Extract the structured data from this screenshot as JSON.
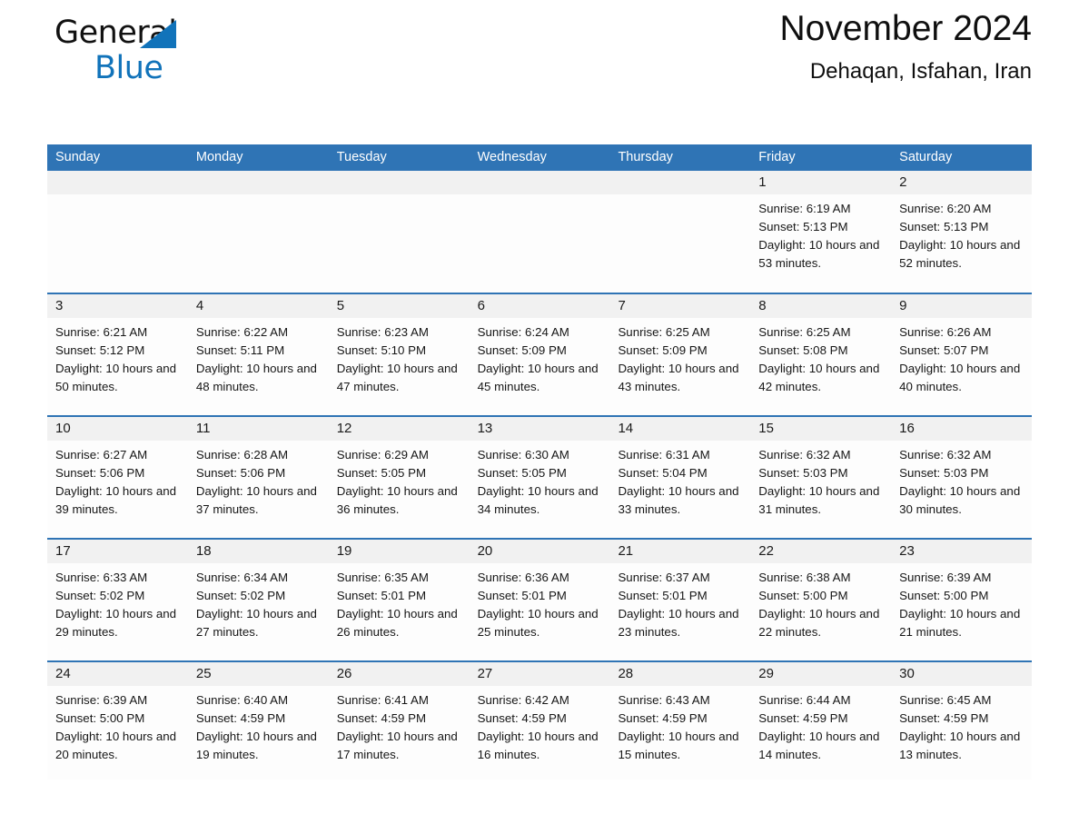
{
  "brand": {
    "line1": "General",
    "line2": "Blue",
    "triangle_icon": "triangle-icon",
    "color_dark": "#111111",
    "color_blue": "#1173ba"
  },
  "header": {
    "month_title": "November 2024",
    "location": "Dehaqan, Isfahan, Iran"
  },
  "theme": {
    "header_blue": "#2f74b5",
    "row_rule_blue": "#2f74b5",
    "daynum_bg": "#f1f1f1",
    "page_bg": "#ffffff"
  },
  "calendar": {
    "weekday_headers": [
      "Sunday",
      "Monday",
      "Tuesday",
      "Wednesday",
      "Thursday",
      "Friday",
      "Saturday"
    ],
    "weeks": [
      [
        {
          "day": "",
          "sunrise": "",
          "sunset": "",
          "daylight": "",
          "empty": true
        },
        {
          "day": "",
          "sunrise": "",
          "sunset": "",
          "daylight": "",
          "empty": true
        },
        {
          "day": "",
          "sunrise": "",
          "sunset": "",
          "daylight": "",
          "empty": true
        },
        {
          "day": "",
          "sunrise": "",
          "sunset": "",
          "daylight": "",
          "empty": true
        },
        {
          "day": "",
          "sunrise": "",
          "sunset": "",
          "daylight": "",
          "empty": true
        },
        {
          "day": "1",
          "sunrise": "Sunrise: 6:19 AM",
          "sunset": "Sunset: 5:13 PM",
          "daylight": "Daylight: 10 hours and 53 minutes.",
          "empty": false
        },
        {
          "day": "2",
          "sunrise": "Sunrise: 6:20 AM",
          "sunset": "Sunset: 5:13 PM",
          "daylight": "Daylight: 10 hours and 52 minutes.",
          "empty": false
        }
      ],
      [
        {
          "day": "3",
          "sunrise": "Sunrise: 6:21 AM",
          "sunset": "Sunset: 5:12 PM",
          "daylight": "Daylight: 10 hours and 50 minutes.",
          "empty": false
        },
        {
          "day": "4",
          "sunrise": "Sunrise: 6:22 AM",
          "sunset": "Sunset: 5:11 PM",
          "daylight": "Daylight: 10 hours and 48 minutes.",
          "empty": false
        },
        {
          "day": "5",
          "sunrise": "Sunrise: 6:23 AM",
          "sunset": "Sunset: 5:10 PM",
          "daylight": "Daylight: 10 hours and 47 minutes.",
          "empty": false
        },
        {
          "day": "6",
          "sunrise": "Sunrise: 6:24 AM",
          "sunset": "Sunset: 5:09 PM",
          "daylight": "Daylight: 10 hours and 45 minutes.",
          "empty": false
        },
        {
          "day": "7",
          "sunrise": "Sunrise: 6:25 AM",
          "sunset": "Sunset: 5:09 PM",
          "daylight": "Daylight: 10 hours and 43 minutes.",
          "empty": false
        },
        {
          "day": "8",
          "sunrise": "Sunrise: 6:25 AM",
          "sunset": "Sunset: 5:08 PM",
          "daylight": "Daylight: 10 hours and 42 minutes.",
          "empty": false
        },
        {
          "day": "9",
          "sunrise": "Sunrise: 6:26 AM",
          "sunset": "Sunset: 5:07 PM",
          "daylight": "Daylight: 10 hours and 40 minutes.",
          "empty": false
        }
      ],
      [
        {
          "day": "10",
          "sunrise": "Sunrise: 6:27 AM",
          "sunset": "Sunset: 5:06 PM",
          "daylight": "Daylight: 10 hours and 39 minutes.",
          "empty": false
        },
        {
          "day": "11",
          "sunrise": "Sunrise: 6:28 AM",
          "sunset": "Sunset: 5:06 PM",
          "daylight": "Daylight: 10 hours and 37 minutes.",
          "empty": false
        },
        {
          "day": "12",
          "sunrise": "Sunrise: 6:29 AM",
          "sunset": "Sunset: 5:05 PM",
          "daylight": "Daylight: 10 hours and 36 minutes.",
          "empty": false
        },
        {
          "day": "13",
          "sunrise": "Sunrise: 6:30 AM",
          "sunset": "Sunset: 5:05 PM",
          "daylight": "Daylight: 10 hours and 34 minutes.",
          "empty": false
        },
        {
          "day": "14",
          "sunrise": "Sunrise: 6:31 AM",
          "sunset": "Sunset: 5:04 PM",
          "daylight": "Daylight: 10 hours and 33 minutes.",
          "empty": false
        },
        {
          "day": "15",
          "sunrise": "Sunrise: 6:32 AM",
          "sunset": "Sunset: 5:03 PM",
          "daylight": "Daylight: 10 hours and 31 minutes.",
          "empty": false
        },
        {
          "day": "16",
          "sunrise": "Sunrise: 6:32 AM",
          "sunset": "Sunset: 5:03 PM",
          "daylight": "Daylight: 10 hours and 30 minutes.",
          "empty": false
        }
      ],
      [
        {
          "day": "17",
          "sunrise": "Sunrise: 6:33 AM",
          "sunset": "Sunset: 5:02 PM",
          "daylight": "Daylight: 10 hours and 29 minutes.",
          "empty": false
        },
        {
          "day": "18",
          "sunrise": "Sunrise: 6:34 AM",
          "sunset": "Sunset: 5:02 PM",
          "daylight": "Daylight: 10 hours and 27 minutes.",
          "empty": false
        },
        {
          "day": "19",
          "sunrise": "Sunrise: 6:35 AM",
          "sunset": "Sunset: 5:01 PM",
          "daylight": "Daylight: 10 hours and 26 minutes.",
          "empty": false
        },
        {
          "day": "20",
          "sunrise": "Sunrise: 6:36 AM",
          "sunset": "Sunset: 5:01 PM",
          "daylight": "Daylight: 10 hours and 25 minutes.",
          "empty": false
        },
        {
          "day": "21",
          "sunrise": "Sunrise: 6:37 AM",
          "sunset": "Sunset: 5:01 PM",
          "daylight": "Daylight: 10 hours and 23 minutes.",
          "empty": false
        },
        {
          "day": "22",
          "sunrise": "Sunrise: 6:38 AM",
          "sunset": "Sunset: 5:00 PM",
          "daylight": "Daylight: 10 hours and 22 minutes.",
          "empty": false
        },
        {
          "day": "23",
          "sunrise": "Sunrise: 6:39 AM",
          "sunset": "Sunset: 5:00 PM",
          "daylight": "Daylight: 10 hours and 21 minutes.",
          "empty": false
        }
      ],
      [
        {
          "day": "24",
          "sunrise": "Sunrise: 6:39 AM",
          "sunset": "Sunset: 5:00 PM",
          "daylight": "Daylight: 10 hours and 20 minutes.",
          "empty": false
        },
        {
          "day": "25",
          "sunrise": "Sunrise: 6:40 AM",
          "sunset": "Sunset: 4:59 PM",
          "daylight": "Daylight: 10 hours and 19 minutes.",
          "empty": false
        },
        {
          "day": "26",
          "sunrise": "Sunrise: 6:41 AM",
          "sunset": "Sunset: 4:59 PM",
          "daylight": "Daylight: 10 hours and 17 minutes.",
          "empty": false
        },
        {
          "day": "27",
          "sunrise": "Sunrise: 6:42 AM",
          "sunset": "Sunset: 4:59 PM",
          "daylight": "Daylight: 10 hours and 16 minutes.",
          "empty": false
        },
        {
          "day": "28",
          "sunrise": "Sunrise: 6:43 AM",
          "sunset": "Sunset: 4:59 PM",
          "daylight": "Daylight: 10 hours and 15 minutes.",
          "empty": false
        },
        {
          "day": "29",
          "sunrise": "Sunrise: 6:44 AM",
          "sunset": "Sunset: 4:59 PM",
          "daylight": "Daylight: 10 hours and 14 minutes.",
          "empty": false
        },
        {
          "day": "30",
          "sunrise": "Sunrise: 6:45 AM",
          "sunset": "Sunset: 4:59 PM",
          "daylight": "Daylight: 10 hours and 13 minutes.",
          "empty": false
        }
      ]
    ]
  }
}
